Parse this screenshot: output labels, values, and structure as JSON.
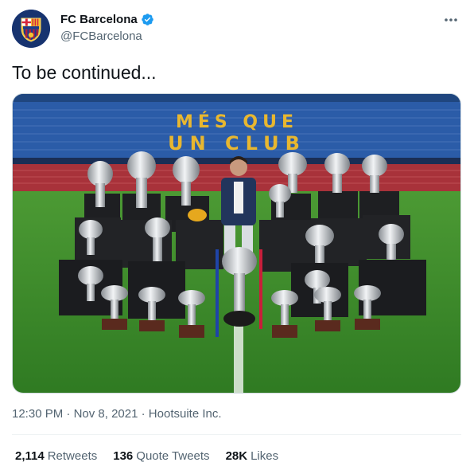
{
  "account": {
    "display_name": "FC Barcelona",
    "handle": "@FCBarcelona",
    "avatar_text": "FCB"
  },
  "icons": {
    "verified": "verified-badge-icon",
    "more": "more-options-icon"
  },
  "tweet": {
    "text": "To be continued..."
  },
  "media": {
    "stadium_slogan_top": "MÉS QUE",
    "stadium_slogan_bottom": "UN CLUB"
  },
  "meta": {
    "time": "12:30 PM",
    "separator1": " · ",
    "date": "Nov 8, 2021",
    "separator2": " · ",
    "source": "Hootsuite Inc."
  },
  "stats": [
    {
      "count": "2,114",
      "label": "Retweets"
    },
    {
      "count": "136",
      "label": "Quote Tweets"
    },
    {
      "count": "28K",
      "label": "Likes"
    }
  ],
  "colors": {
    "verified_blue": "#1d9bf0",
    "secondary_text": "#536471",
    "pitch_green": "#3f8a2c",
    "seat_blue": "#2a5aa8",
    "seat_red": "#a8323a",
    "slogan_yellow": "#e8b730"
  }
}
